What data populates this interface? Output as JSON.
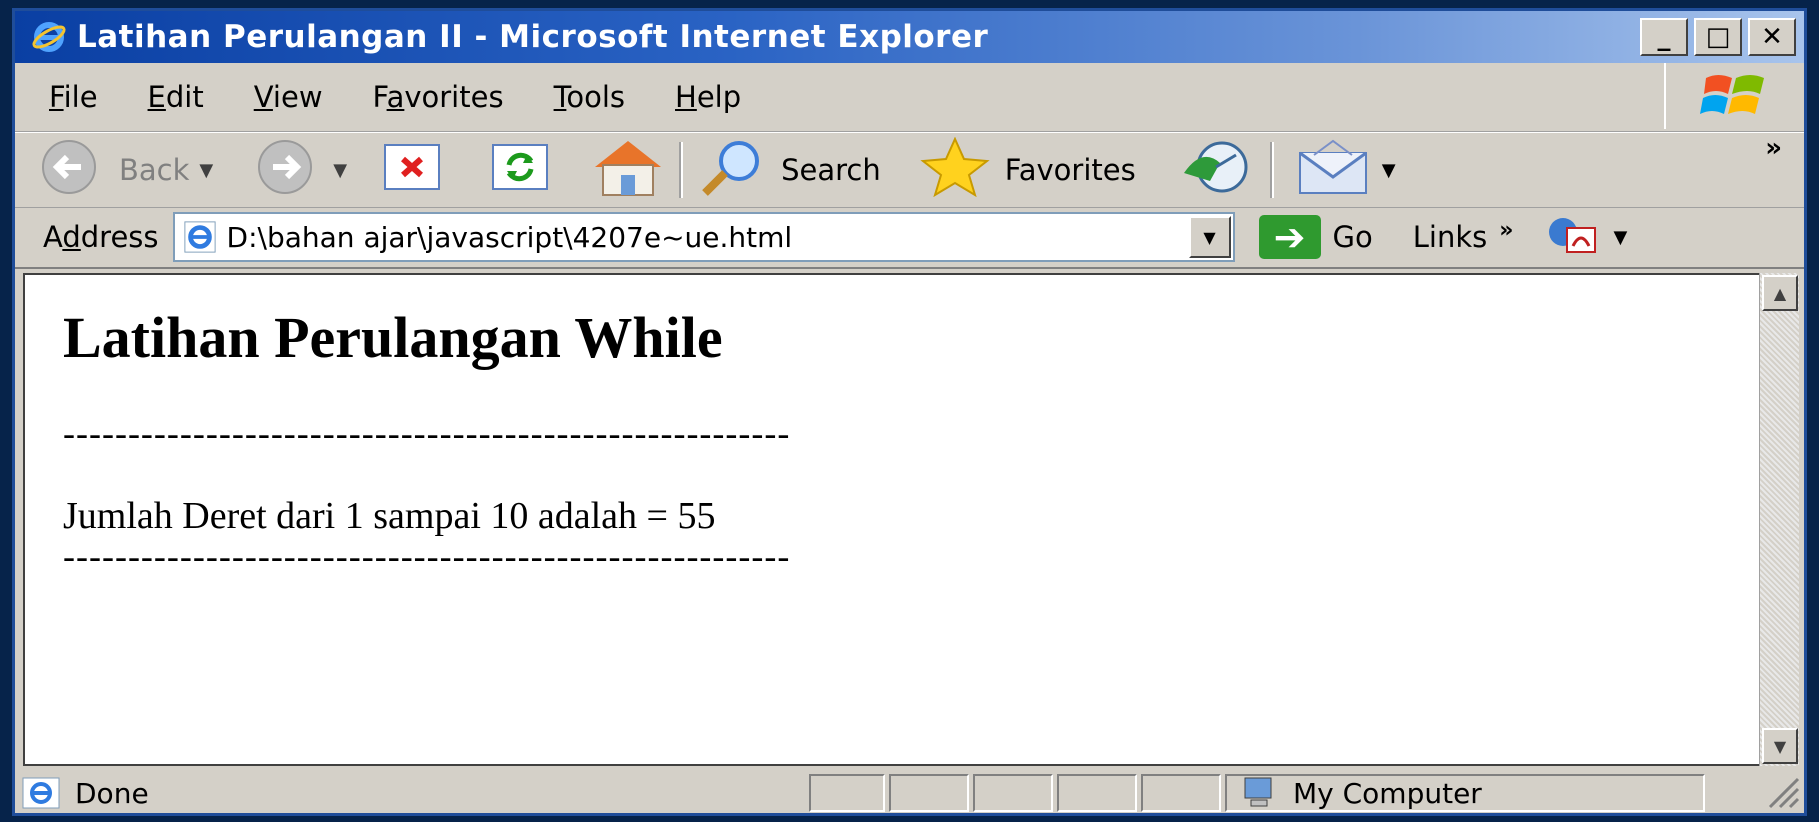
{
  "window": {
    "title": "Latihan Perulangan II - Microsoft Internet Explorer",
    "caption_buttons": [
      "_",
      "□",
      "✕"
    ]
  },
  "menu": {
    "items": [
      {
        "label": "File",
        "accel": "F",
        "rest": "ile"
      },
      {
        "label": "Edit",
        "accel": "E",
        "rest": "dit"
      },
      {
        "label": "View",
        "accel": "V",
        "rest": "iew"
      },
      {
        "label": "Favorites",
        "pre": "F",
        "accel": "a",
        "rest": "vorites"
      },
      {
        "label": "Tools",
        "accel": "T",
        "rest": "ools"
      },
      {
        "label": "Help",
        "accel": "H",
        "rest": "elp"
      }
    ]
  },
  "toolbar": {
    "back_label": "Back",
    "search_label": "Search",
    "favorites_label": "Favorites",
    "more": "»"
  },
  "addressbar": {
    "label_pre": "A",
    "label_accel": "d",
    "label_rest": "dress",
    "url": "D:\\bahan ajar\\javascript\\4207e~ue.html",
    "go_label": "Go",
    "links_label": "Links",
    "more": "»"
  },
  "page": {
    "heading": "Latihan Perulangan While",
    "separator": "--------------------------------------------------------",
    "result": "Jumlah Deret dari 1 sampai 10 adalah = 55",
    "separator2": "--------------------------------------------------------"
  },
  "status": {
    "text": "Done",
    "zone": "My Computer"
  },
  "colors": {
    "titlebar_start": "#0a3fa3",
    "chrome": "#d4d0c8",
    "desktop": "#06234a"
  }
}
